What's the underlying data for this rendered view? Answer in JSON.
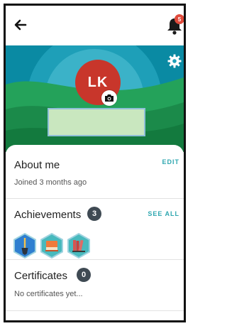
{
  "header": {
    "notification_count": "5",
    "icons": {
      "back": "arrow-left-icon",
      "bell": "bell-icon",
      "settings": "gear-icon",
      "camera": "camera-icon"
    }
  },
  "profile": {
    "initials": "LK"
  },
  "about": {
    "title": "About me",
    "action": "EDIT",
    "subtitle": "Joined 3 months ago"
  },
  "achievements": {
    "title": "Achievements",
    "count": "3",
    "action": "SEE ALL",
    "badges": [
      {
        "icon": "shovel-icon",
        "color": "#2f7fd0"
      },
      {
        "icon": "book-icon",
        "color": "#48b9bd"
      },
      {
        "icon": "books-icon",
        "color": "#48b9bd"
      }
    ]
  },
  "certificates": {
    "title": "Certificates",
    "count": "0",
    "subtitle": "No certificates yet..."
  },
  "colors": {
    "accent": "#2fa7b0",
    "avatar": "#c8362b",
    "badge": "#e04a3b",
    "pill": "#3f4a53"
  }
}
